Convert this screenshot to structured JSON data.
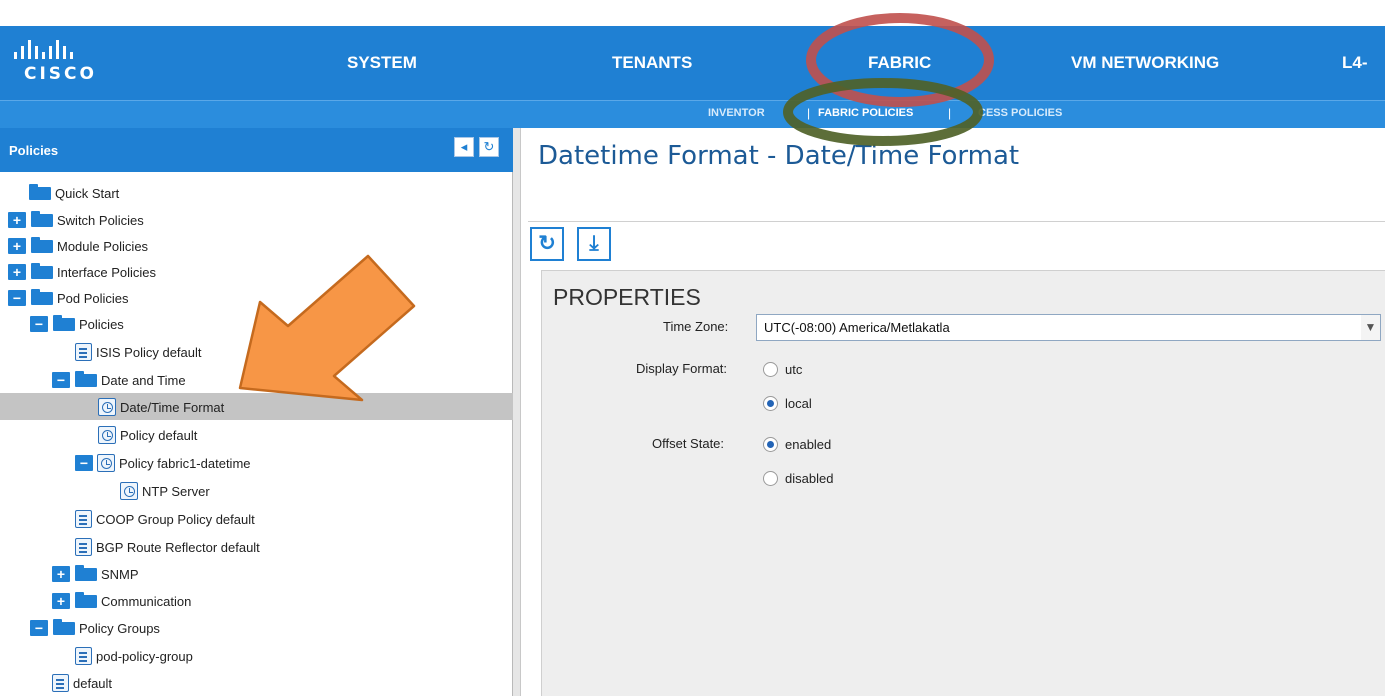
{
  "header": {
    "logo_text": "CISCO",
    "nav": [
      "SYSTEM",
      "TENANTS",
      "FABRIC",
      "VM NETWORKING",
      "L4-"
    ],
    "active_nav": "FABRIC",
    "subnav": [
      "INVENTOR",
      "FABRIC POLICIES",
      "CESS POLICIES"
    ],
    "active_subnav": "FABRIC POLICIES",
    "subnav_separator": "|"
  },
  "left_panel": {
    "title": "Policies",
    "tree": [
      {
        "label": "Quick Start"
      },
      {
        "label": "Switch Policies",
        "toggle": "+"
      },
      {
        "label": "Module Policies",
        "toggle": "+"
      },
      {
        "label": "Interface Policies",
        "toggle": "+"
      },
      {
        "label": "Pod Policies",
        "toggle": "−"
      },
      {
        "label": "Policies",
        "toggle": "−"
      },
      {
        "label": "ISIS Policy default"
      },
      {
        "label": "Date and Time",
        "toggle": "−"
      },
      {
        "label": "Date/Time Format",
        "selected": true
      },
      {
        "label": "Policy default"
      },
      {
        "label": "Policy fabric1-datetime",
        "toggle": "−"
      },
      {
        "label": "NTP Server"
      },
      {
        "label": "COOP Group Policy default"
      },
      {
        "label": "BGP Route Reflector default"
      },
      {
        "label": "SNMP",
        "toggle": "+"
      },
      {
        "label": "Communication",
        "toggle": "+"
      },
      {
        "label": "Policy Groups",
        "toggle": "−"
      },
      {
        "label": "pod-policy-group"
      },
      {
        "label": "default"
      }
    ]
  },
  "content": {
    "title": "Datetime Format - Date/Time Format",
    "section": "PROPERTIES",
    "time_zone_label": "Time Zone:",
    "time_zone_value": "UTC(-08:00) America/Metlakatla",
    "display_format_label": "Display Format:",
    "display_format_options": [
      "utc",
      "local"
    ],
    "display_format_selected": "local",
    "offset_state_label": "Offset State:",
    "offset_state_options": [
      "enabled",
      "disabled"
    ],
    "offset_state_selected": "enabled"
  },
  "colors": {
    "header_blue": "#1f80d3",
    "annotation_red": "#c0504d",
    "annotation_green": "#4f6228",
    "annotation_arrow": "#f79646"
  },
  "icons": {
    "left_toolbar": [
      "collapse-icon",
      "refresh-icon"
    ],
    "content_toolbar": [
      "refresh-icon",
      "download-icon"
    ]
  }
}
